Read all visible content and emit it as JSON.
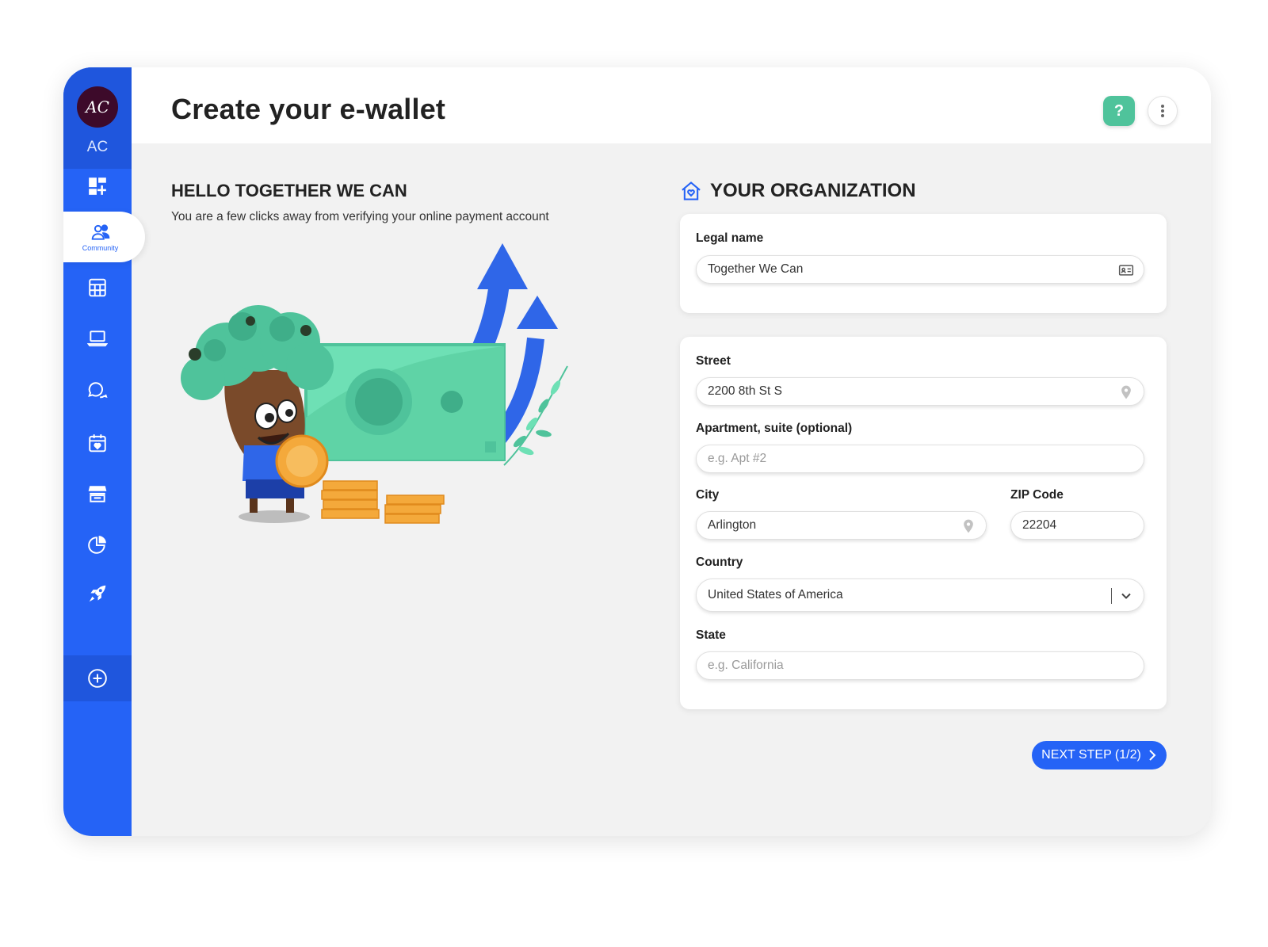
{
  "user": {
    "initials": "AC",
    "name": "AC"
  },
  "sidebar": {
    "items": [
      {
        "icon": "dashboard-add-icon"
      },
      {
        "icon": "community-icon",
        "label": "Community",
        "active": true
      },
      {
        "icon": "calculator-icon"
      },
      {
        "icon": "laptop-icon"
      },
      {
        "icon": "chat-icon"
      },
      {
        "icon": "calendar-icon"
      },
      {
        "icon": "store-icon"
      },
      {
        "icon": "pie-chart-icon"
      },
      {
        "icon": "rocket-icon"
      }
    ],
    "add_icon": "plus-circle-icon"
  },
  "header": {
    "title": "Create your e-wallet",
    "help_label": "?"
  },
  "intro": {
    "title": "HELLO TOGETHER WE CAN",
    "subtitle": "You are a few clicks away from verifying your online payment account"
  },
  "organization": {
    "title": "YOUR ORGANIZATION",
    "legal_name": {
      "label": "Legal name",
      "value": "Together We Can"
    },
    "street": {
      "label": "Street",
      "value": "2200 8th St S"
    },
    "apartment": {
      "label": "Apartment, suite (optional)",
      "placeholder": "e.g. Apt #2"
    },
    "city": {
      "label": "City",
      "value": "Arlington"
    },
    "zip": {
      "label": "ZIP Code",
      "value": "22204"
    },
    "country": {
      "label": "Country",
      "value": "United States of America"
    },
    "state": {
      "label": "State",
      "placeholder": "e.g. California"
    }
  },
  "actions": {
    "next_label": "NEXT STEP (1/2)"
  },
  "colors": {
    "primary": "#2563f6",
    "help": "#4fc39b",
    "bill": "#6ee0b5"
  }
}
